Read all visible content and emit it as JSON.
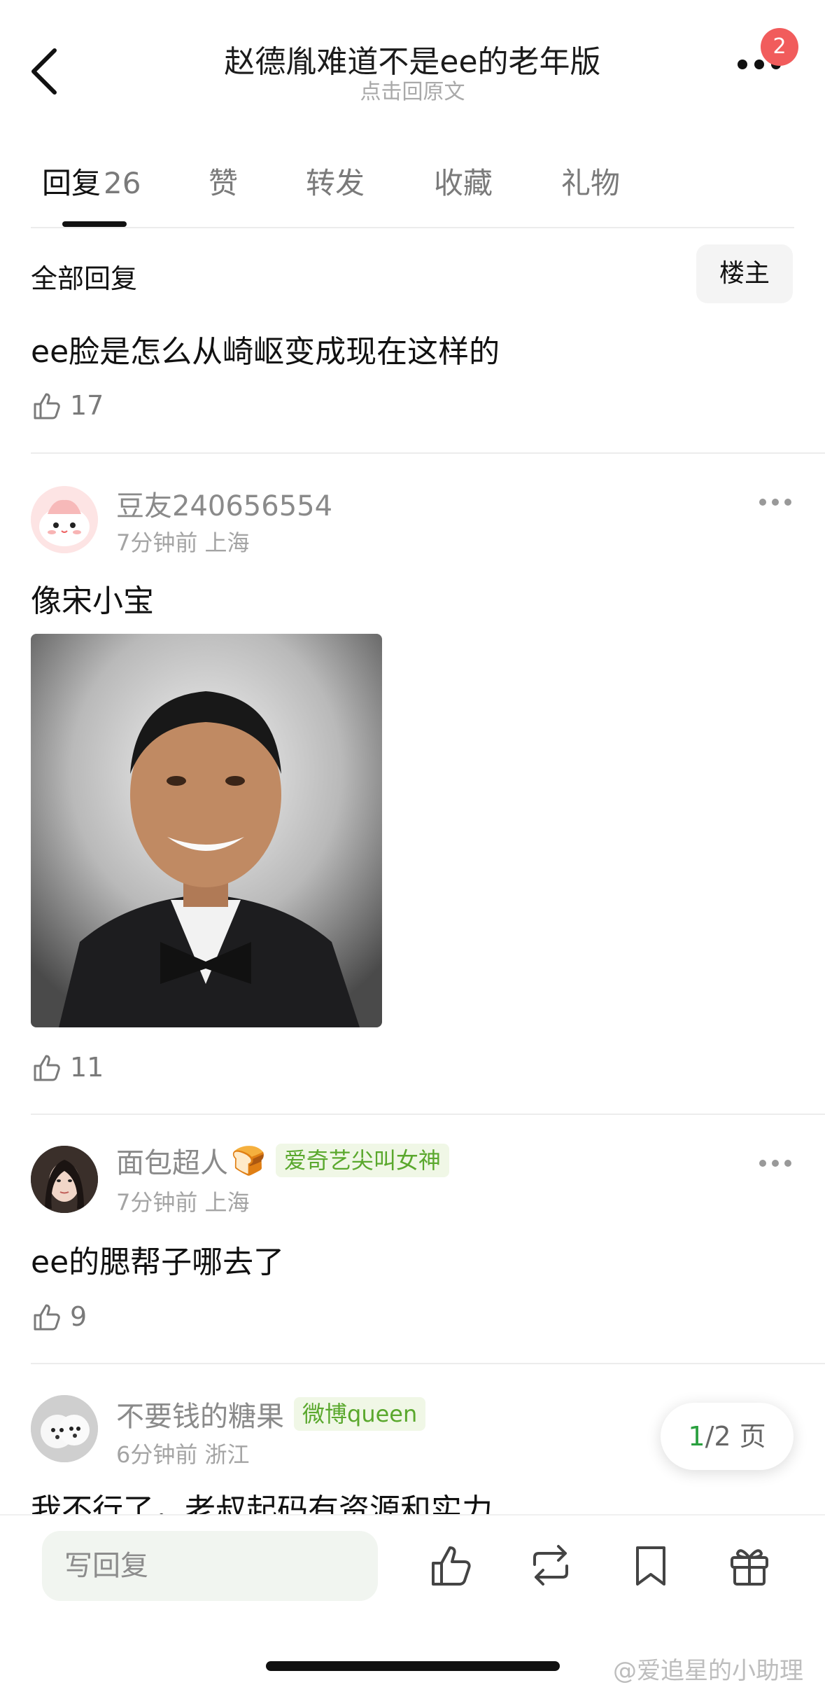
{
  "header": {
    "title": "赵德胤难道不是ee的老年版",
    "subtitle": "点击回原文",
    "notification_count": "2"
  },
  "tabs": [
    {
      "label": "回复",
      "count": "26"
    },
    {
      "label": "赞"
    },
    {
      "label": "转发"
    },
    {
      "label": "收藏"
    },
    {
      "label": "礼物"
    }
  ],
  "filter": {
    "all_replies": "全部回复",
    "op_button": "楼主"
  },
  "original_post": {
    "text": "ee脸是怎么从崎岖变成现在这样的",
    "likes": "17"
  },
  "comments": [
    {
      "username": "豆友240656554",
      "time": "7分钟前",
      "location": "上海",
      "text": "像宋小宝",
      "likes": "11",
      "avatar_icon": "cartoon-blob-avatar"
    },
    {
      "username": "面包超人",
      "emoji": "🍞",
      "tag": "爱奇艺尖叫女神",
      "time": "7分钟前",
      "location": "上海",
      "text": "ee的腮帮子哪去了",
      "likes": "9",
      "avatar_icon": "woman-portrait-avatar"
    },
    {
      "username": "不要钱的糖果",
      "tag": "微博queen",
      "time": "6分钟前",
      "location": "浙江",
      "text": "我不行了，老叔起码有资源和实力",
      "avatar_icon": "dog-portrait-avatar"
    }
  ],
  "pagination": {
    "current": "1",
    "total": "/2 页"
  },
  "bottom_bar": {
    "reply_placeholder": "写回复"
  },
  "watermark": "@爱追星的小助理",
  "colors": {
    "accent_green": "#2aa03f",
    "tag_green": "#5aa82d",
    "badge_red": "#f15c5c"
  }
}
